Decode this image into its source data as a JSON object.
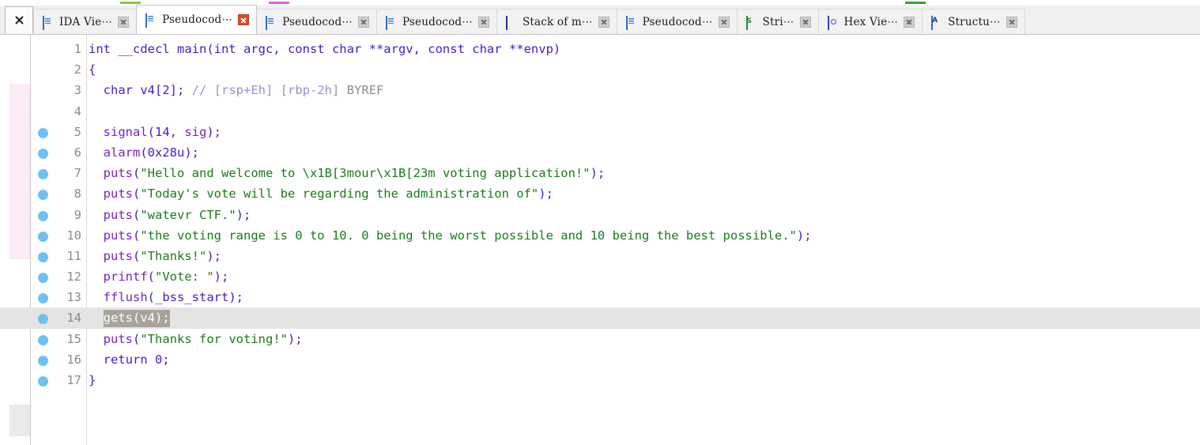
{
  "window": {
    "close_all_label": "×",
    "close_all_title": "Close all tabs"
  },
  "tabs": [
    {
      "label": "IDA Vie⋯",
      "icon": "document-icon",
      "active": false,
      "close_state": "gray"
    },
    {
      "label": "Pseudocod⋯",
      "icon": "document-icon",
      "active": true,
      "close_state": "red"
    },
    {
      "label": "Pseudocod⋯",
      "icon": "document-icon",
      "active": false,
      "close_state": "gray"
    },
    {
      "label": "Pseudocod⋯",
      "icon": "document-icon",
      "active": false,
      "close_state": "gray"
    },
    {
      "label": "Stack of m⋯",
      "icon": "stack-icon",
      "active": false,
      "close_state": "gray"
    },
    {
      "label": "Pseudocod⋯",
      "icon": "document-icon",
      "active": false,
      "close_state": "gray"
    },
    {
      "label": "Stri⋯",
      "icon": "strings-icon",
      "active": false,
      "close_state": "gray"
    },
    {
      "label": "Hex Vie⋯",
      "icon": "hex-icon",
      "active": false,
      "close_state": "gray"
    },
    {
      "label": "Structu⋯",
      "icon": "structures-icon",
      "active": false,
      "close_state": "gray"
    }
  ],
  "colors": {
    "keyword": "#3b1fd0",
    "function": "#7b20c8",
    "string": "#1a7a1a",
    "comment": "#8e8e8e",
    "comment_bracket": "#a08ad8",
    "breakpoint_dot": "#6ec1f0",
    "selection": "#a8a49b",
    "current_line": "#e4e4e4",
    "left_band_pink": "#fceaf6",
    "left_band_gray": "#eaeaea",
    "active_tab_close": "#e04a26"
  },
  "editor": {
    "highlighted_line": 14,
    "selected_text": "gets(v4);",
    "lines": [
      {
        "n": "1",
        "bp": false,
        "hl": false,
        "tokens": [
          {
            "t": "int __cdecl ",
            "c": "kw"
          },
          {
            "t": "main",
            "c": "plain"
          },
          {
            "t": "(int argc, const char **argv, const char **envp)",
            "c": "plain"
          }
        ]
      },
      {
        "n": "2",
        "bp": false,
        "hl": false,
        "tokens": [
          {
            "t": "{",
            "c": "pun"
          }
        ]
      },
      {
        "n": "3",
        "bp": false,
        "hl": false,
        "tokens": [
          {
            "t": "  char v4",
            "c": "kw"
          },
          {
            "t": "[2]",
            "c": "pun"
          },
          {
            "t": "; ",
            "c": "kw"
          },
          {
            "t": "//",
            "c": "cmtb"
          },
          {
            "t": " ",
            "c": "cmt"
          },
          {
            "t": "[rsp+Eh] [rbp-2h]",
            "c": "cmtb"
          },
          {
            "t": " BYREF",
            "c": "cmt"
          }
        ]
      },
      {
        "n": "4",
        "bp": false,
        "hl": false,
        "tokens": []
      },
      {
        "n": "5",
        "bp": true,
        "hl": false,
        "tokens": [
          {
            "t": "  ",
            "c": "plain"
          },
          {
            "t": "signal",
            "c": "fn"
          },
          {
            "t": "(14, ",
            "c": "kw"
          },
          {
            "t": "sig",
            "c": "fn"
          },
          {
            "t": ");",
            "c": "kw"
          }
        ]
      },
      {
        "n": "6",
        "bp": true,
        "hl": false,
        "tokens": [
          {
            "t": "  ",
            "c": "plain"
          },
          {
            "t": "alarm",
            "c": "fn"
          },
          {
            "t": "(0x28u);",
            "c": "kw"
          }
        ]
      },
      {
        "n": "7",
        "bp": true,
        "hl": false,
        "tokens": [
          {
            "t": "  ",
            "c": "plain"
          },
          {
            "t": "puts",
            "c": "fn"
          },
          {
            "t": "(",
            "c": "kw"
          },
          {
            "t": "\"Hello and welcome to \\x1B[3mour\\x1B[23m voting application!\"",
            "c": "str"
          },
          {
            "t": ");",
            "c": "kw"
          }
        ]
      },
      {
        "n": "8",
        "bp": true,
        "hl": false,
        "tokens": [
          {
            "t": "  ",
            "c": "plain"
          },
          {
            "t": "puts",
            "c": "fn"
          },
          {
            "t": "(",
            "c": "kw"
          },
          {
            "t": "\"Today's vote will be regarding the administration of\"",
            "c": "str"
          },
          {
            "t": ");",
            "c": "kw"
          }
        ]
      },
      {
        "n": "9",
        "bp": true,
        "hl": false,
        "tokens": [
          {
            "t": "  ",
            "c": "plain"
          },
          {
            "t": "puts",
            "c": "fn"
          },
          {
            "t": "(",
            "c": "kw"
          },
          {
            "t": "\"watevr CTF.\"",
            "c": "str"
          },
          {
            "t": ");",
            "c": "kw"
          }
        ]
      },
      {
        "n": "10",
        "bp": true,
        "hl": false,
        "tokens": [
          {
            "t": "  ",
            "c": "plain"
          },
          {
            "t": "puts",
            "c": "fn"
          },
          {
            "t": "(",
            "c": "kw"
          },
          {
            "t": "\"the voting range is 0 to 10. 0 being the worst possible and 10 being the best possible.\"",
            "c": "str"
          },
          {
            "t": ");",
            "c": "kw"
          }
        ]
      },
      {
        "n": "11",
        "bp": true,
        "hl": false,
        "tokens": [
          {
            "t": "  ",
            "c": "plain"
          },
          {
            "t": "puts",
            "c": "fn"
          },
          {
            "t": "(",
            "c": "kw"
          },
          {
            "t": "\"Thanks!\"",
            "c": "str"
          },
          {
            "t": ");",
            "c": "kw"
          }
        ]
      },
      {
        "n": "12",
        "bp": true,
        "hl": false,
        "tokens": [
          {
            "t": "  ",
            "c": "plain"
          },
          {
            "t": "printf",
            "c": "fn"
          },
          {
            "t": "(",
            "c": "kw"
          },
          {
            "t": "\"Vote: \"",
            "c": "str"
          },
          {
            "t": ");",
            "c": "kw"
          }
        ]
      },
      {
        "n": "13",
        "bp": true,
        "hl": false,
        "tokens": [
          {
            "t": "  ",
            "c": "plain"
          },
          {
            "t": "fflush",
            "c": "fn"
          },
          {
            "t": "(_bss_start);",
            "c": "kw"
          }
        ]
      },
      {
        "n": "14",
        "bp": true,
        "hl": true,
        "tokens": [
          {
            "t": "  ",
            "c": "plain"
          },
          {
            "t": "gets(v4);",
            "c": "sel"
          }
        ]
      },
      {
        "n": "15",
        "bp": true,
        "hl": false,
        "tokens": [
          {
            "t": "  ",
            "c": "plain"
          },
          {
            "t": "puts",
            "c": "fn"
          },
          {
            "t": "(",
            "c": "kw"
          },
          {
            "t": "\"Thanks for voting!\"",
            "c": "str"
          },
          {
            "t": ");",
            "c": "kw"
          }
        ]
      },
      {
        "n": "16",
        "bp": true,
        "hl": false,
        "tokens": [
          {
            "t": "  return 0;",
            "c": "kw"
          }
        ]
      },
      {
        "n": "17",
        "bp": true,
        "hl": false,
        "tokens": [
          {
            "t": "}",
            "c": "pun"
          }
        ]
      }
    ]
  }
}
